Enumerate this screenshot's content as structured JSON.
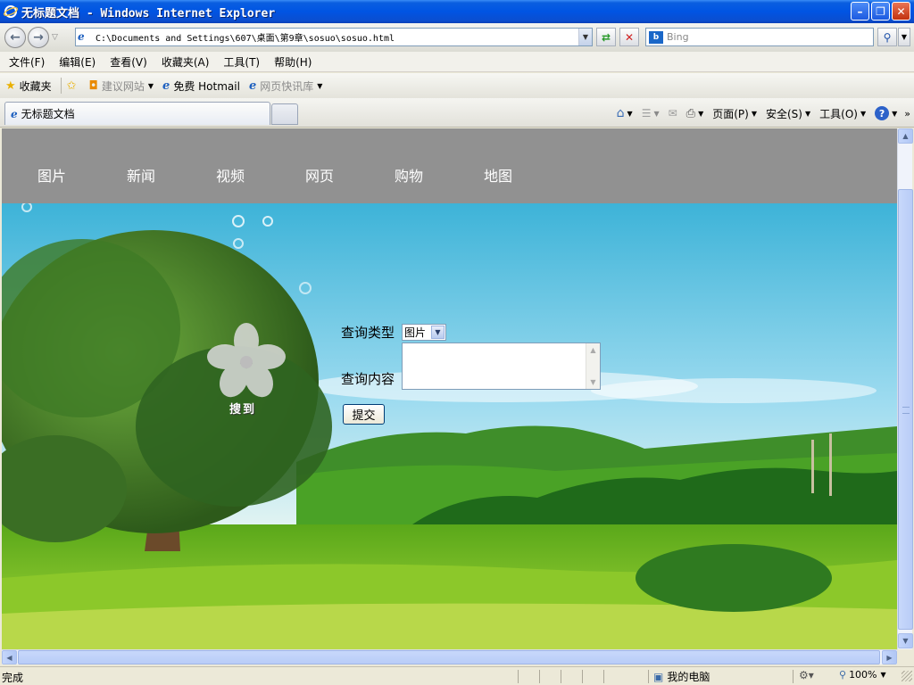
{
  "window": {
    "title": "无标题文档 - Windows Internet Explorer",
    "minimize_label": "–",
    "restore_label": "❐",
    "close_label": "✕"
  },
  "address": {
    "url": "C:\\Documents and Settings\\607\\桌面\\第9章\\sosuo\\sosuo.html",
    "search_placeholder": "Bing"
  },
  "menu": [
    "文件(F)",
    "编辑(E)",
    "查看(V)",
    "收藏夹(A)",
    "工具(T)",
    "帮助(H)"
  ],
  "favorites": {
    "label": "收藏夹",
    "items": [
      "建议网站",
      "免费 Hotmail",
      "网页快讯库"
    ]
  },
  "tab": {
    "title": "无标题文档"
  },
  "command_bar": {
    "page": "页面(P)",
    "safety": "安全(S)",
    "tools": "工具(O)"
  },
  "site": {
    "nav": [
      "图片",
      "新闻",
      "视频",
      "网页",
      "购物",
      "地图"
    ],
    "logo_text": "搜到",
    "form": {
      "type_label": "查询类型",
      "type_value": "图片",
      "content_label": "查询内容",
      "submit_label": "提交"
    }
  },
  "status": {
    "text": "完成",
    "zone": "我的电脑",
    "zoom": "100%"
  },
  "colors": {
    "titlebar": "#0054e3",
    "nav_band": "#919191",
    "sky": "#8fd3ea",
    "grass": "#7cc61e"
  }
}
